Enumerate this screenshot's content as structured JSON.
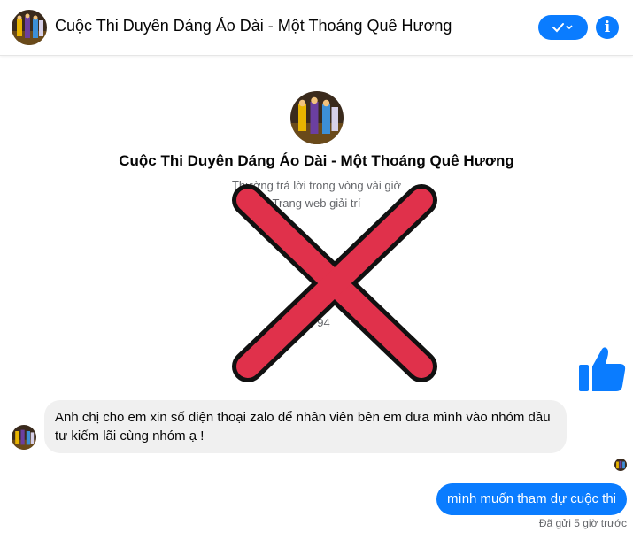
{
  "header": {
    "title": "Cuộc Thi Duyên Dáng Áo Dài - Một Thoáng Quê Hương",
    "action_icon": "check-chevron-icon",
    "info_icon": "info-icon"
  },
  "profile": {
    "name": "Cuộc Thi Duyên Dáng Áo Dài - Một Thoáng Quê Hương",
    "response_time": "Thường trả lời trong vòng vài giờ",
    "category": "Trang web giải trí",
    "partial_text": "94"
  },
  "overlay": {
    "icon": "red-x-mark-icon",
    "color": "#e0314b"
  },
  "messages": {
    "incoming": "Anh chị cho em xin số điện thoại zalo để nhân viên bên em đưa mình vào nhóm đầu tư kiếm lãi cùng nhóm ạ !",
    "outgoing": "mình muốn tham dự cuộc thi",
    "status": "Đã gửi 5 giờ trước"
  },
  "colors": {
    "accent": "#0a7cff",
    "bubble_in": "#f0f0f0"
  }
}
